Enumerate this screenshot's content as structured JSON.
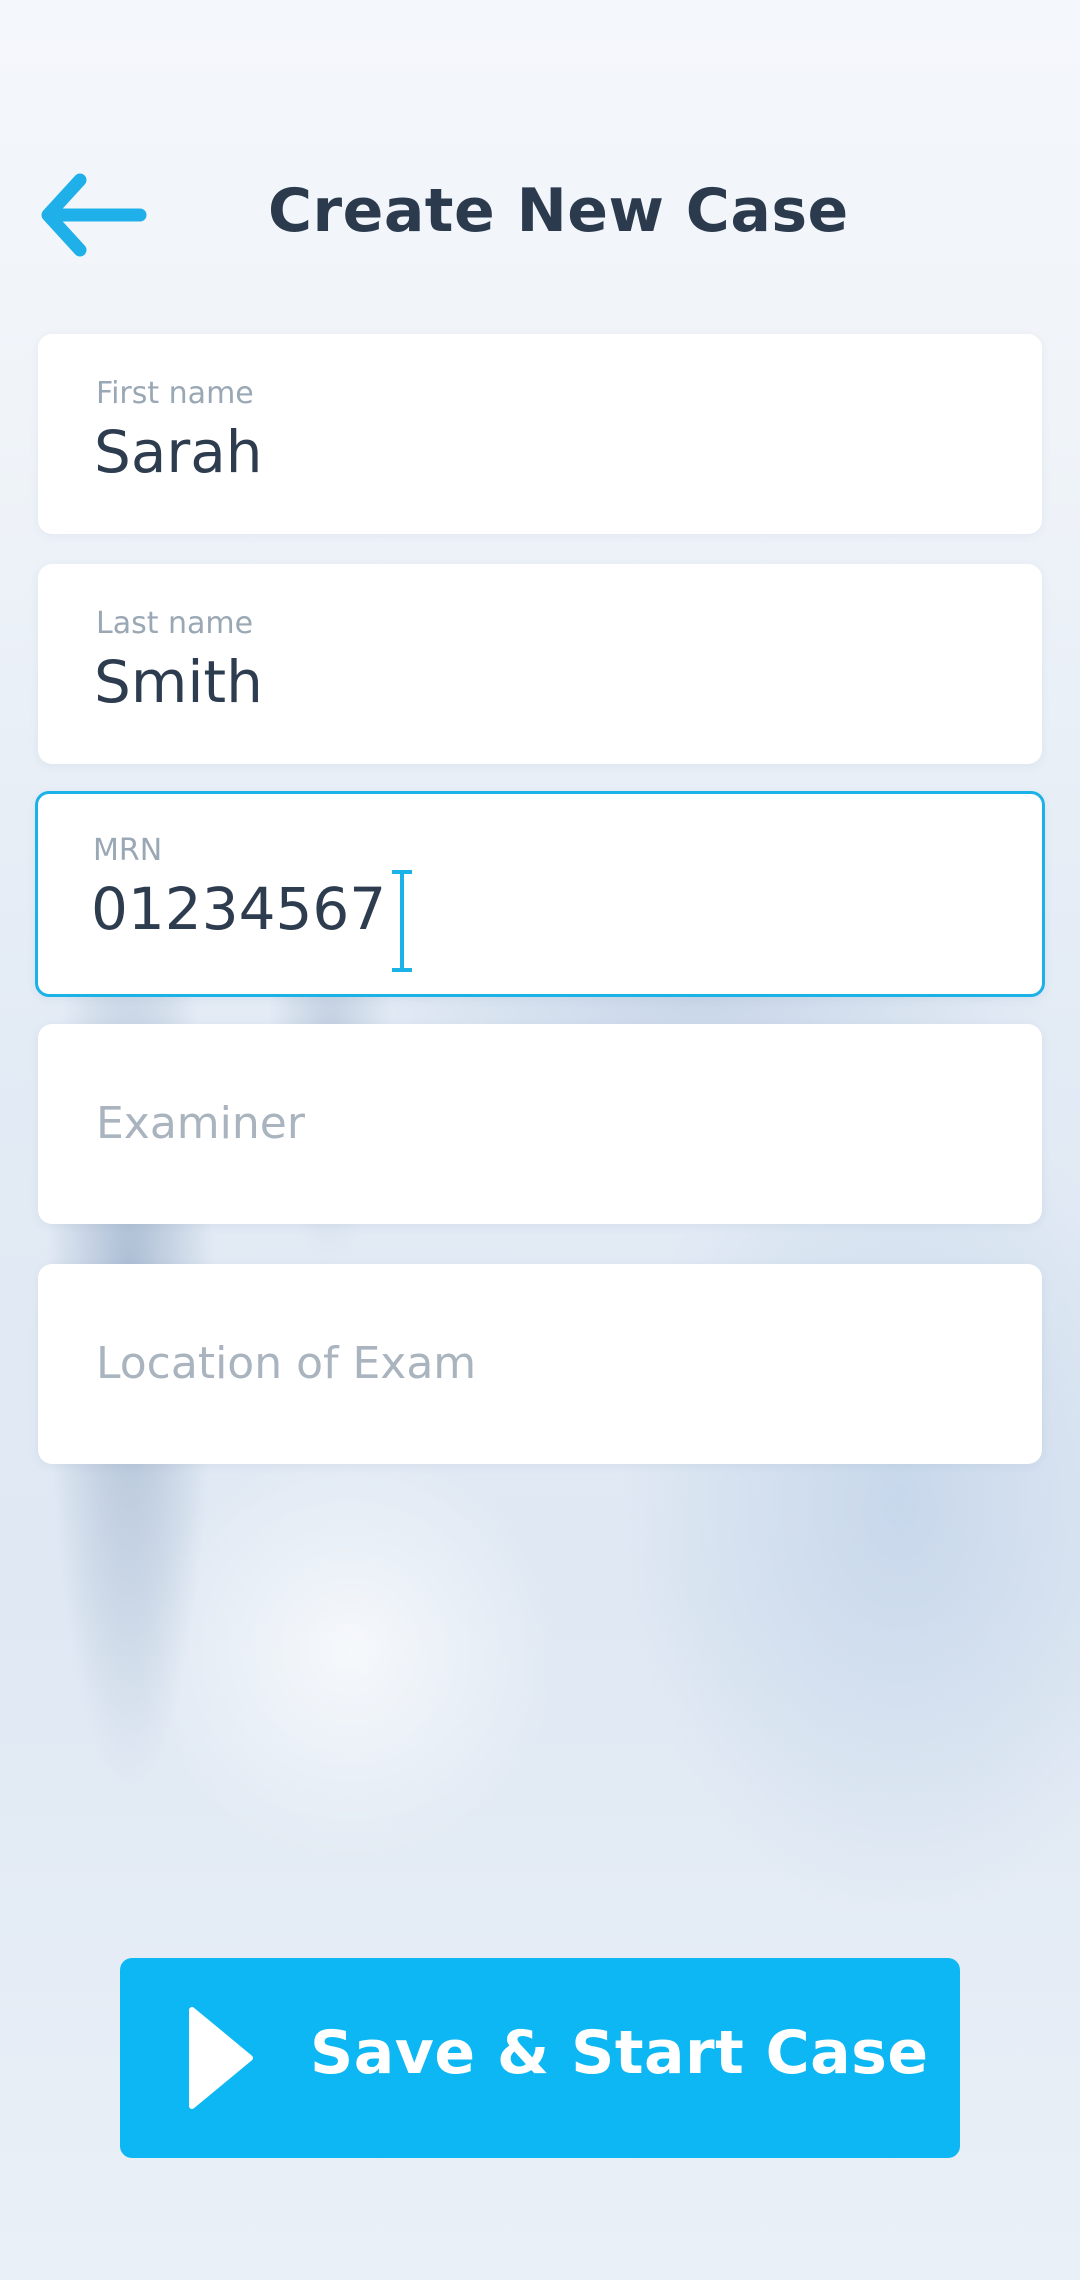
{
  "header": {
    "title": "Create New Case",
    "back_icon": "arrow-left-icon"
  },
  "form": {
    "first_name": {
      "label": "First name",
      "value": "Sarah"
    },
    "last_name": {
      "label": "Last name",
      "value": "Smith"
    },
    "mrn": {
      "label": "MRN",
      "value": "01234567",
      "focused": true
    },
    "examiner": {
      "placeholder": "Examiner",
      "value": ""
    },
    "location": {
      "placeholder": "Location of Exam",
      "value": ""
    }
  },
  "actions": {
    "save_label": "Save & Start Case",
    "save_icon": "play-icon"
  },
  "colors": {
    "accent": "#0db7f3",
    "focus_border": "#1bb2e8",
    "text_dark": "#2e3c4f",
    "text_muted": "#9aa7b4"
  }
}
